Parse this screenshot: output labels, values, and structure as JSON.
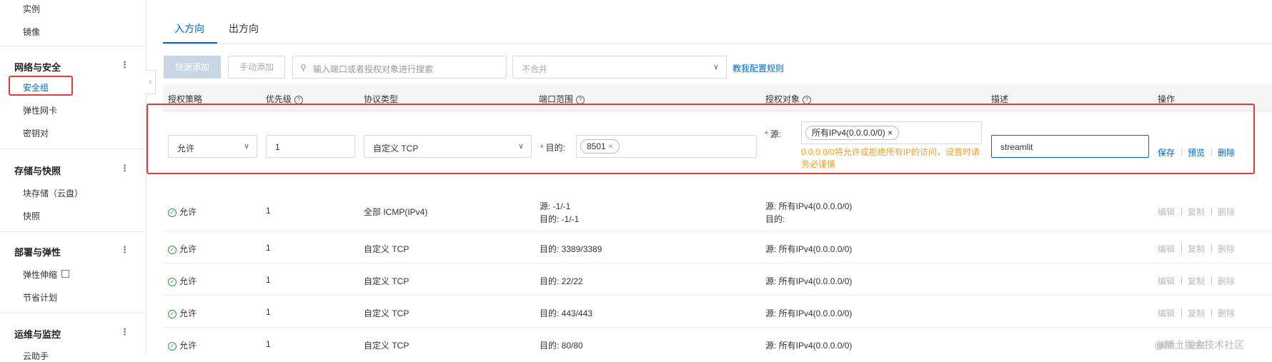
{
  "sidebar": {
    "top_items": [
      "实例",
      "镜像"
    ],
    "groups": [
      {
        "title": "网络与安全",
        "items": [
          "安全组",
          "弹性网卡",
          "密钥对"
        ]
      },
      {
        "title": "存储与快照",
        "items": [
          "块存储（云盘）",
          "快照"
        ]
      },
      {
        "title": "部署与弹性",
        "items": [
          "弹性伸缩",
          "节省计划"
        ]
      },
      {
        "title": "运维与监控",
        "items": [
          "云助手"
        ]
      }
    ],
    "active_item": "安全组",
    "more_icon": "⋮",
    "collapse_icon": "‹"
  },
  "tabs": [
    {
      "label": "入方向",
      "active": true
    },
    {
      "label": "出方向",
      "active": false
    }
  ],
  "toolbar": {
    "quick_add": "快速添加",
    "manual_add": "手动添加",
    "search_placeholder": "输入端口或者授权对象进行搜索",
    "merge_value": "不合并",
    "help_link": "教我配置规则"
  },
  "table": {
    "headers": [
      "授权策略",
      "优先级",
      "协议类型",
      "端口范围",
      "授权对象",
      "描述",
      "操作"
    ]
  },
  "edit_row": {
    "policy": "允许",
    "priority": "1",
    "protocol": "自定义 TCP",
    "port_label": "目的:",
    "port_tag": "8501",
    "source_label": "源:",
    "source_tag": "所有IPv4(0.0.0.0/0)",
    "warning": "0.0.0.0/0将允许或拒绝所有IP的访问，设置时请务必谨慎",
    "description": "streamlit",
    "actions": [
      "保存",
      "预览",
      "删除"
    ]
  },
  "rows": [
    {
      "policy": "允许",
      "priority": "1",
      "protocol": "全部 ICMP(IPv4)",
      "port": "源: -1/-1",
      "port2": "目的: -1/-1",
      "target": "源: 所有IPv4(0.0.0.0/0)",
      "target2": "目的:"
    },
    {
      "policy": "允许",
      "priority": "1",
      "protocol": "自定义 TCP",
      "port": "目的: 3389/3389",
      "port2": "",
      "target": "源: 所有IPv4(0.0.0.0/0)",
      "target2": ""
    },
    {
      "policy": "允许",
      "priority": "1",
      "protocol": "自定义 TCP",
      "port": "目的: 22/22",
      "port2": "",
      "target": "源: 所有IPv4(0.0.0.0/0)",
      "target2": ""
    },
    {
      "policy": "允许",
      "priority": "1",
      "protocol": "自定义 TCP",
      "port": "目的: 443/443",
      "port2": "",
      "target": "源: 所有IPv4(0.0.0.0/0)",
      "target2": ""
    },
    {
      "policy": "允许",
      "priority": "1",
      "protocol": "自定义 TCP",
      "port": "目的: 80/80",
      "port2": "",
      "target": "源: 所有IPv4(0.0.0.0/0)",
      "target2": ""
    }
  ],
  "row_actions": [
    "编辑",
    "复制",
    "删除"
  ],
  "watermark": "@稀土掘金技术社区",
  "colors": {
    "accent": "#0064c8",
    "highlight": "#e23b3b",
    "warning": "#f0a020",
    "ok": "#2c9c40"
  }
}
